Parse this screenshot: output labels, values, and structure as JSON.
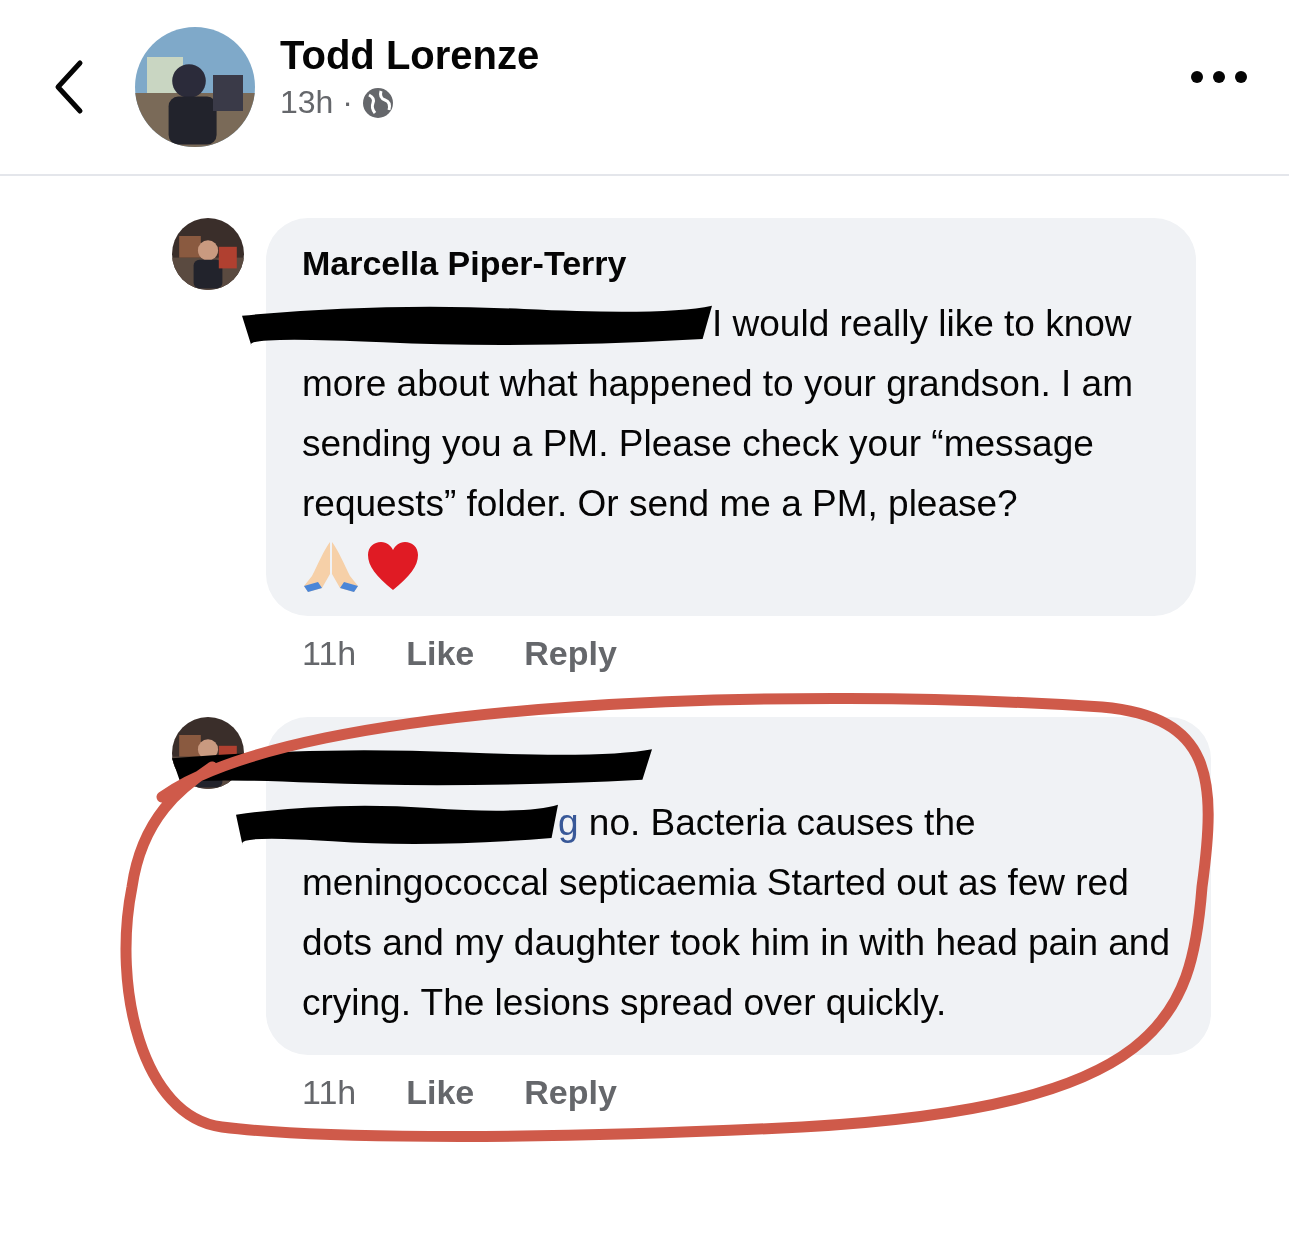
{
  "header": {
    "title": "Todd Lorenze",
    "time": "13h ·"
  },
  "comments": [
    {
      "author": "Marcella Piper-Terry",
      "mention_redacted": true,
      "text": "I would really like to know more about what happened to your grandson. I am sending you a PM. Please check your “message requests” folder. Or send me a PM, please?",
      "emojis": [
        {
          "kind": "pray"
        },
        {
          "kind": "heart"
        }
      ],
      "time": "11h",
      "like": "Like",
      "reply": "Reply"
    },
    {
      "author_redacted": true,
      "mention_redacted": true,
      "mention_fragment": "g",
      "text": "no. Bacteria causes the meningococcal septicaemia Started out as few red dots and my daughter took him in with head pain and crying. The lesions spread over quickly.",
      "time": "11h",
      "like": "Like",
      "reply": "Reply",
      "circled": true
    }
  ]
}
